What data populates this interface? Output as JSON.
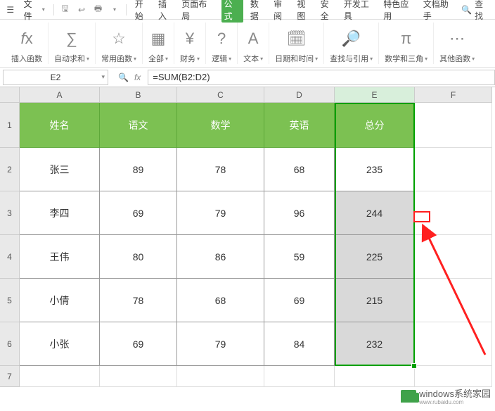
{
  "menu": {
    "file": "文件",
    "tabs": [
      "开始",
      "插入",
      "页面布局",
      "公式",
      "数据",
      "审阅",
      "视图",
      "安全",
      "开发工具",
      "特色应用",
      "文档助手"
    ],
    "active_tab_index": 3,
    "search": "查找"
  },
  "ribbon": {
    "insert_fn": "插入函数",
    "autosum": "自动求和",
    "common_fn": "常用函数",
    "all": "全部",
    "financial": "财务",
    "logical": "逻辑",
    "text": "文本",
    "datetime": "日期和时间",
    "lookup": "查找与引用",
    "math": "数学和三角",
    "other": "其他函数"
  },
  "formula_bar": {
    "name_box": "E2",
    "formula": "=SUM(B2:D2)"
  },
  "columns": [
    "A",
    "B",
    "C",
    "D",
    "E",
    "F"
  ],
  "row_numbers": [
    "1",
    "2",
    "3",
    "4",
    "5",
    "6",
    "7"
  ],
  "headers": [
    "姓名",
    "语文",
    "数学",
    "英语",
    "总分"
  ],
  "data_rows": [
    {
      "name": "张三",
      "chinese": "89",
      "math": "78",
      "english": "68",
      "total": "235"
    },
    {
      "name": "李四",
      "chinese": "69",
      "math": "79",
      "english": "96",
      "total": "244"
    },
    {
      "name": "王伟",
      "chinese": "80",
      "math": "86",
      "english": "59",
      "total": "225"
    },
    {
      "name": "小倩",
      "chinese": "78",
      "math": "68",
      "english": "69",
      "total": "215"
    },
    {
      "name": "小张",
      "chinese": "69",
      "math": "79",
      "english": "84",
      "total": "232"
    }
  ],
  "watermark": {
    "text": "windows系统家园",
    "sub": "www.rubaidu.com"
  }
}
